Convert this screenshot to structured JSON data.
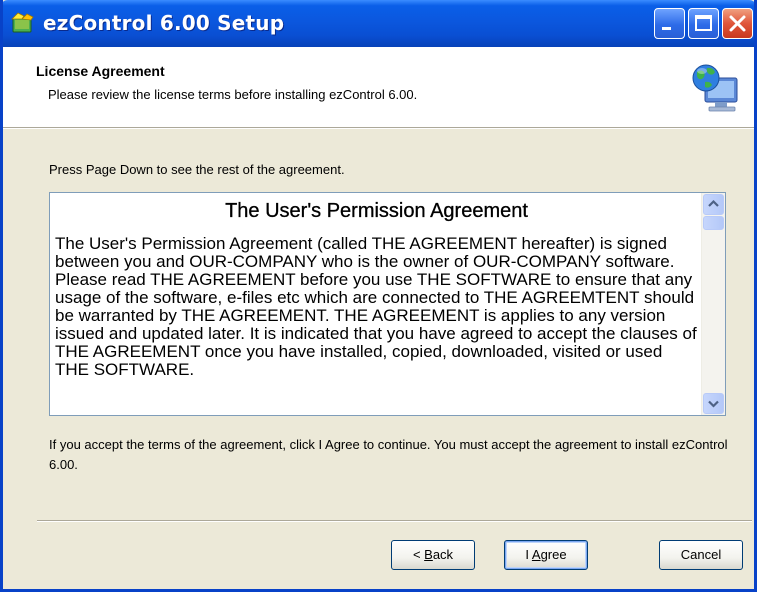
{
  "window": {
    "title": "ezControl 6.00 Setup"
  },
  "header": {
    "title": "License Agreement",
    "subtitle": "Please review the license terms before installing ezControl 6.00."
  },
  "instruction": "Press Page Down to see the rest of the agreement.",
  "license": {
    "heading": "The User's Permission Agreement",
    "body": "The User's Permission Agreement (called THE AGREEMENT hereafter) is signed between you and OUR-COMPANY who is the owner of OUR-COMPANY software. Please read THE AGREEMENT before you use THE SOFTWARE to ensure that any usage of the software, e-files etc which are connected to THE AGREEMTENT should be warranted by THE AGREEMENT. THE AGREEMENT is applies to any version issued and updated later. It is indicated that you have agreed to accept the clauses of THE AGREEMENT once you have installed, copied, downloaded, visited or used THE SOFTWARE."
  },
  "accept_text": "If you accept the terms of the agreement, click I Agree to continue. You must accept the agreement to install ezControl 6.00.",
  "buttons": {
    "back": {
      "prefix": "< ",
      "mnemonic": "B",
      "rest": "ack"
    },
    "agree": {
      "prefix": "I ",
      "mnemonic": "A",
      "rest": "gree"
    },
    "cancel": "Cancel"
  },
  "icons": {
    "app": "installer-icon",
    "header": "globe-computer-icon",
    "minimize": "minimize-icon",
    "maximize": "maximize-icon",
    "close": "close-icon",
    "scroll_up": "scroll-up-arrow-icon",
    "scroll_down": "scroll-down-arrow-icon"
  },
  "colors": {
    "titlebar": "#0A57E0",
    "dialog_bg": "#ECE9D8",
    "close_button": "#E0553A",
    "button_border": "#003C74"
  }
}
